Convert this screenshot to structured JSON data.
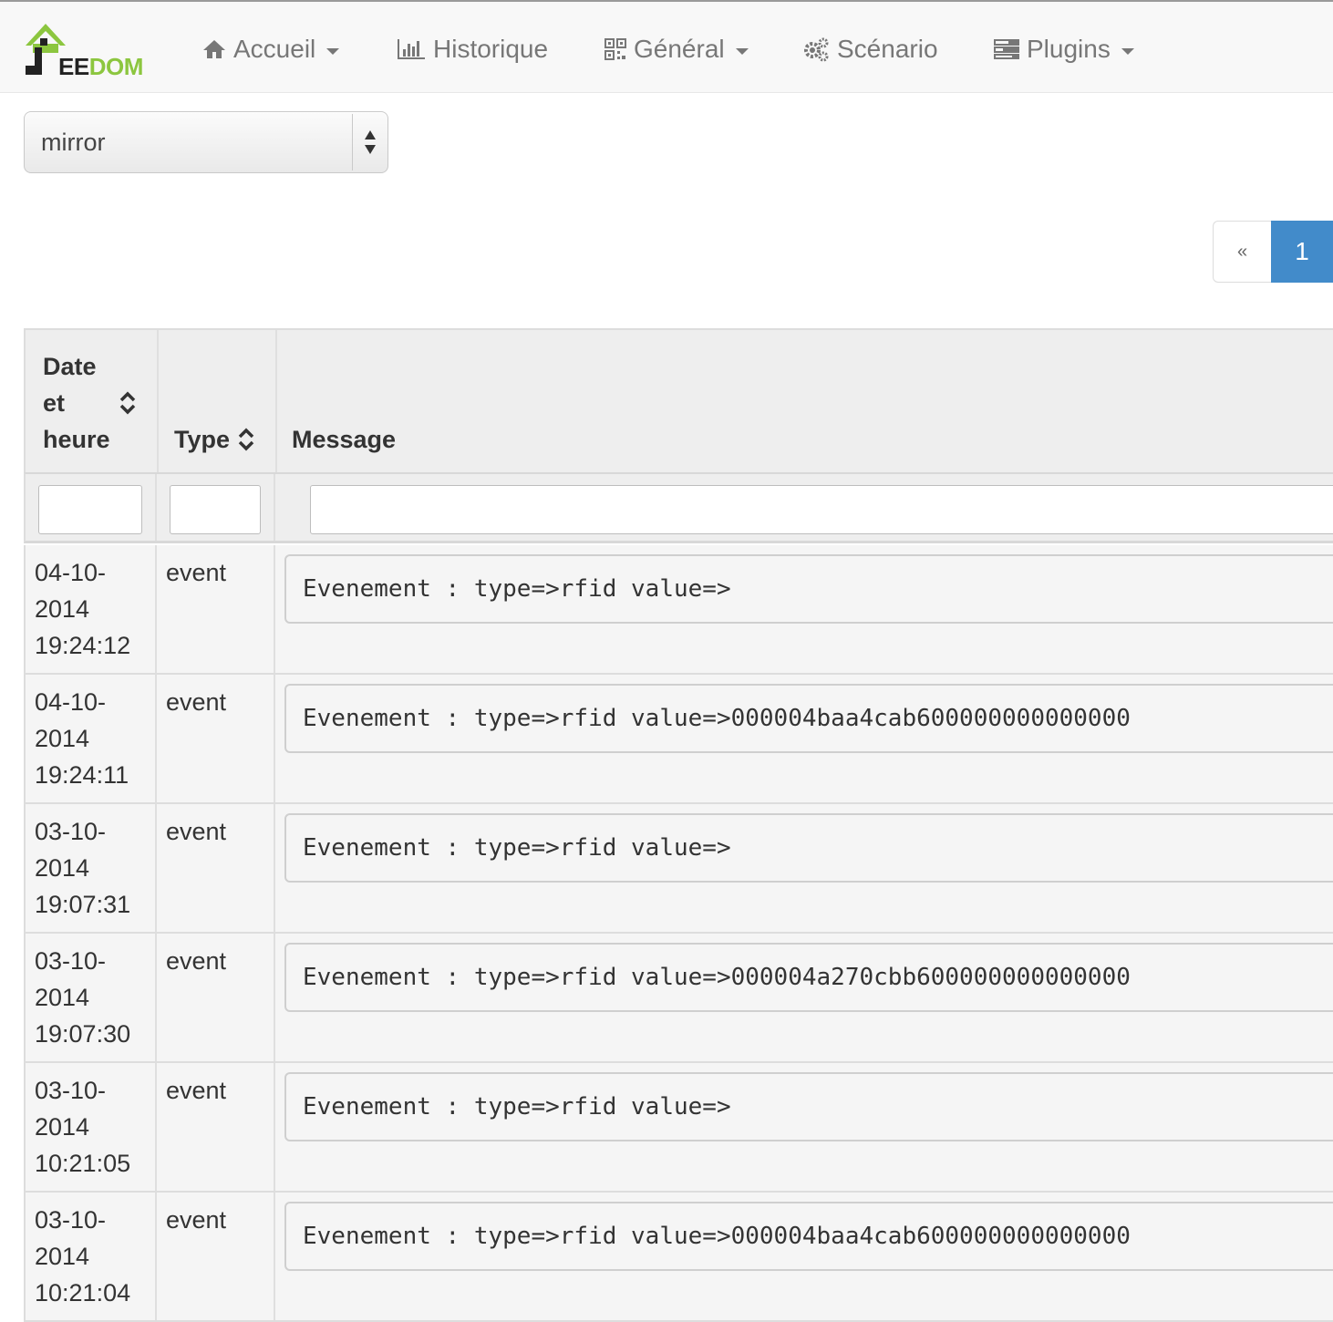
{
  "brand": {
    "logo_text_e": "EE",
    "logo_text_dom": "DOM"
  },
  "nav": [
    {
      "label": "Accueil",
      "icon": "home-icon",
      "dropdown": true
    },
    {
      "label": "Historique",
      "icon": "bar-chart-icon",
      "dropdown": false
    },
    {
      "label": "Général",
      "icon": "qrcode-icon",
      "dropdown": true
    },
    {
      "label": "Scénario",
      "icon": "cogs-icon",
      "dropdown": false
    },
    {
      "label": "Plugins",
      "icon": "tasks-icon",
      "dropdown": true
    }
  ],
  "log_select": {
    "value": "mirror"
  },
  "pagination": {
    "prev": "«",
    "current": "1",
    "active_color": "#428bca"
  },
  "table": {
    "headers": {
      "date_line1": "Date",
      "date_line2": "et",
      "date_line3": "heure",
      "type": "Type",
      "message": "Message"
    },
    "rows": [
      {
        "date": [
          "04-10-",
          "2014",
          "19:24:12"
        ],
        "type": "event",
        "message": "Evenement : type=>rfid value=>"
      },
      {
        "date": [
          "04-10-",
          "2014",
          "19:24:11"
        ],
        "type": "event",
        "message": "Evenement : type=>rfid value=>000004baa4cab600000000000000"
      },
      {
        "date": [
          "03-10-",
          "2014",
          "19:07:31"
        ],
        "type": "event",
        "message": "Evenement : type=>rfid value=>"
      },
      {
        "date": [
          "03-10-",
          "2014",
          "19:07:30"
        ],
        "type": "event",
        "message": "Evenement : type=>rfid value=>000004a270cbb600000000000000"
      },
      {
        "date": [
          "03-10-",
          "2014",
          "10:21:05"
        ],
        "type": "event",
        "message": "Evenement : type=>rfid value=>"
      },
      {
        "date": [
          "03-10-",
          "2014",
          "10:21:04"
        ],
        "type": "event",
        "message": "Evenement : type=>rfid value=>000004baa4cab600000000000000"
      }
    ]
  }
}
